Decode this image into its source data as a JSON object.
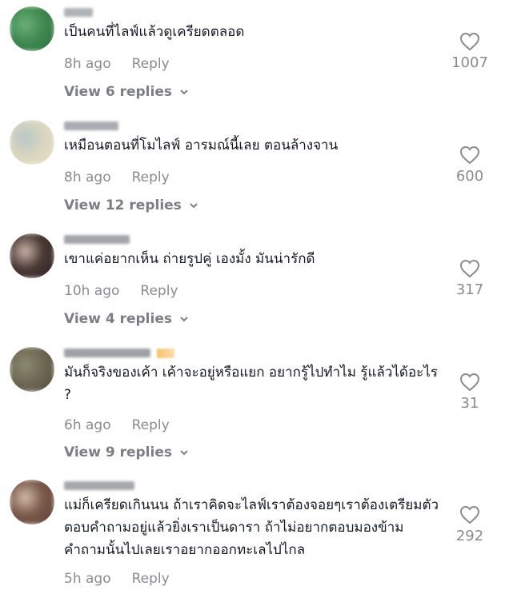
{
  "comments": [
    {
      "text": "เป็นคนที่ไลฟ์แล้วดูเครียดตลอด",
      "time": "8h ago",
      "reply_label": "Reply",
      "view_replies": "View 6 replies",
      "likes": "1007",
      "avatar_colors": [
        "#3f8a52",
        "#6fae7a",
        "#2f6b3f"
      ]
    },
    {
      "text": "เหมือนตอนที่โมไลฟ์ อารมณ์นี้เลย ตอนล้างจาน",
      "time": "8h ago",
      "reply_label": "Reply",
      "view_replies": "View 12 replies",
      "likes": "600",
      "avatar_colors": [
        "#d8d4bf",
        "#b9c7c9",
        "#e9dfc4"
      ]
    },
    {
      "text": "เขาแค่อยากเห็น ถ่ายรูปคู่ เองมั้ง มันน่ารักดี",
      "time": "10h ago",
      "reply_label": "Reply",
      "view_replies": "View 4 replies",
      "likes": "317",
      "avatar_colors": [
        "#4a3a36",
        "#c9b2a6",
        "#2b2220"
      ]
    },
    {
      "text": "มันก็จริงของเค้า เค้าจะอยู่หรือแยก อยากรู้ไปทำไม รู้แล้วได้อะไร ?",
      "time": "6h ago",
      "reply_label": "Reply",
      "view_replies": "View 9 replies",
      "likes": "31",
      "avatar_colors": [
        "#6e6a55",
        "#8c8a72",
        "#4d4b3c"
      ]
    },
    {
      "text": "แม่ก็เครียดเกินนน ถ้าเราคิดจะไลฟ์เราต้องจอยๆเราต้องเตรียมตัวตอบคำถามอยู่แล้วยิ่งเราเป็นดารา ถ้าไม่อยากตอบมองข้ามคำถามนั้นไปเลยเราอยากออกทะเลไปไกล",
      "time": "5h ago",
      "reply_label": "Reply",
      "likes": "292",
      "avatar_colors": [
        "#7a5a4a",
        "#d2b9a6",
        "#5e4034"
      ]
    }
  ]
}
